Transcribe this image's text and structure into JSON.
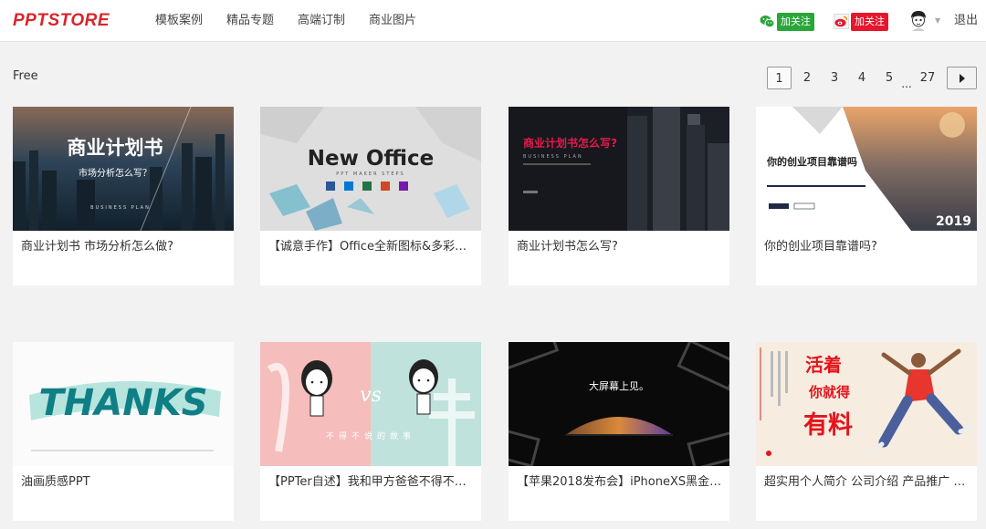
{
  "header": {
    "logo": "PPTSTORE",
    "nav": [
      "模板案例",
      "精品专题",
      "高端订制",
      "商业图片"
    ],
    "wechat_follow": "加关注",
    "weibo_follow": "加关注",
    "logout": "退出"
  },
  "section": {
    "title": "Free"
  },
  "pagination": {
    "pages": [
      "1",
      "2",
      "3",
      "4",
      "5"
    ],
    "ellipsis": "...",
    "last": "27",
    "current": "1"
  },
  "cards": [
    {
      "title": "商业计划书 市场分析怎么做?",
      "thumb": {
        "heading": "商业计划书",
        "sub": "市场分析怎么写？",
        "tag": "BUSINESS PLAN"
      }
    },
    {
      "title": "【诚意手作】Office全新图标&多彩磁贴...",
      "thumb": {
        "heading": "New Office",
        "sub": "PPT MAKER STEPS"
      }
    },
    {
      "title": "商业计划书怎么写?",
      "thumb": {
        "heading": "商业计划书怎么写?",
        "sub": "BUSINESS PLAN"
      }
    },
    {
      "title": "你的创业项目靠谱吗?",
      "thumb": {
        "heading": "你的创业项目靠谱吗",
        "year": "2019"
      }
    },
    {
      "title": "油画质感PPT",
      "thumb": {
        "heading": "THANKS"
      }
    },
    {
      "title": "【PPTer自述】我和甲方爸爸不得不说的故事",
      "thumb": {
        "vs": "vs",
        "sub": "不得不说的故事"
      }
    },
    {
      "title": "【苹果2018发布会】iPhoneXS黑金版...",
      "thumb": {
        "heading": "大屏幕上见。"
      }
    },
    {
      "title": "超实用个人简介 公司介绍 产品推广 项目展示",
      "thumb": {
        "line1": "活着",
        "line2": "你就得",
        "line3": "有料"
      }
    }
  ]
}
